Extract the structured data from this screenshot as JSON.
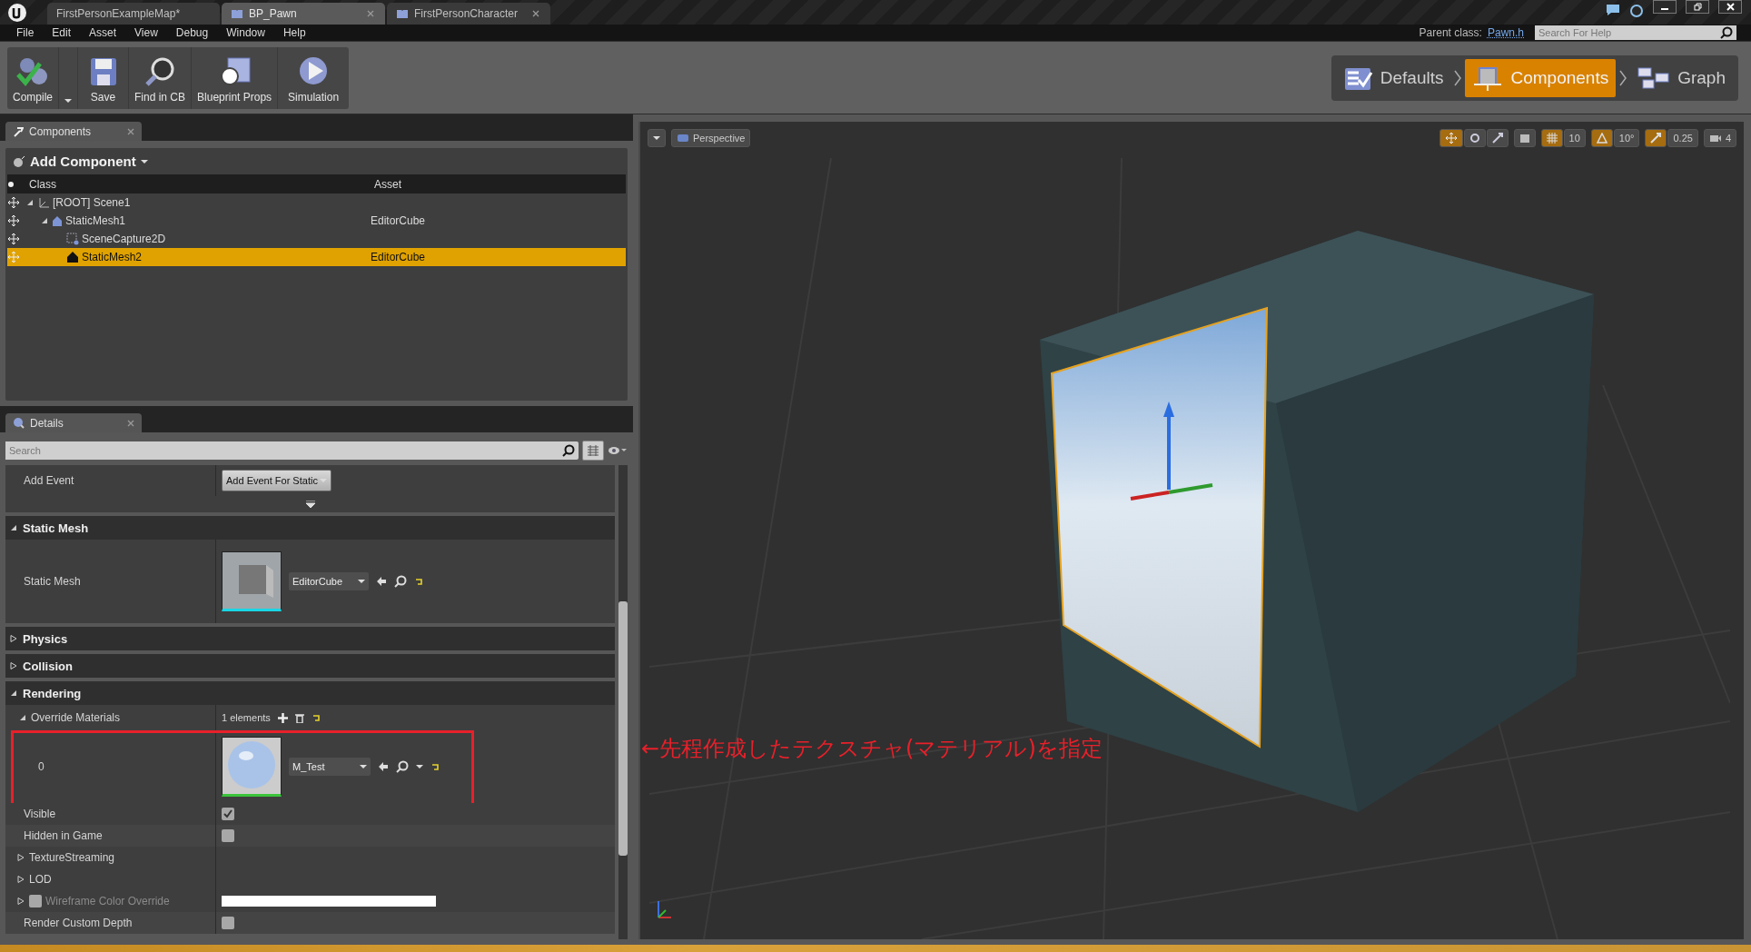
{
  "window": {
    "tabs": [
      {
        "label": "FirstPersonExampleMap*",
        "selected": false
      },
      {
        "label": "BP_Pawn",
        "selected": true
      },
      {
        "label": "FirstPersonCharacter",
        "selected": false
      }
    ]
  },
  "menu": [
    "File",
    "Edit",
    "Asset",
    "View",
    "Debug",
    "Window",
    "Help"
  ],
  "parent_class": {
    "label": "Parent class:",
    "link": "Pawn.h"
  },
  "help_search": {
    "placeholder": "Search For Help"
  },
  "toolbar": [
    {
      "label": "Compile"
    },
    {
      "label": "Save"
    },
    {
      "label": "Find in CB"
    },
    {
      "label": "Blueprint Props"
    },
    {
      "label": "Simulation"
    }
  ],
  "modes": [
    {
      "label": "Defaults",
      "selected": false
    },
    {
      "label": "Components",
      "selected": true
    },
    {
      "label": "Graph",
      "selected": false
    }
  ],
  "components_panel": {
    "tab": "Components",
    "add_button": "Add Component",
    "columns": [
      "Class",
      "Asset"
    ],
    "tree": [
      {
        "kind": "scene",
        "class": "[ROOT] Scene1",
        "selected": false,
        "expanded": true,
        "children": [
          {
            "kind": "mesh",
            "class": "StaticMesh1",
            "asset": "EditorCube",
            "selected": false,
            "expanded": true,
            "children": [
              {
                "kind": "capture",
                "class": "SceneCapture2D",
                "selected": false
              },
              {
                "kind": "solid",
                "class": "StaticMesh2",
                "asset": "EditorCube",
                "selected": true
              }
            ]
          }
        ]
      }
    ]
  },
  "details_panel": {
    "tab": "Details",
    "search": {
      "placeholder": "Search"
    },
    "sections": [
      {
        "rows": [
          {
            "kind": "event",
            "label": "Add Event",
            "button": "Add Event For Static"
          }
        ]
      },
      {
        "title": "Static Mesh",
        "expanded": true,
        "rows": [
          {
            "kind": "asset",
            "label": "Static Mesh",
            "value": "EditorCube"
          }
        ]
      },
      {
        "title": "Physics",
        "expanded": false
      },
      {
        "title": "Collision",
        "expanded": false
      },
      {
        "title": "Rendering",
        "expanded": true,
        "rows": [
          {
            "kind": "array",
            "label": "Override Materials",
            "expanded": true,
            "value": "1 elements"
          },
          {
            "kind": "material",
            "label": "0",
            "value": "M_Test",
            "highlighted": true
          },
          {
            "kind": "checkbox",
            "label": "Visible",
            "checked": true
          },
          {
            "kind": "checkbox",
            "label": "Hidden in Game",
            "checked": false
          },
          {
            "kind": "group",
            "label": "TextureStreaming",
            "expanded": false
          },
          {
            "kind": "group",
            "label": "LOD",
            "expanded": false
          },
          {
            "kind": "color",
            "label": "Wireframe Color Override",
            "expanded": false,
            "checked": false,
            "disabled": true
          },
          {
            "kind": "checkbox",
            "label": "Render Custom Depth",
            "checked": false
          }
        ]
      }
    ]
  },
  "annotation": {
    "text": "←先程作成したテクスチャ(マテリアル)を指定"
  },
  "viewport": {
    "view_button": "Perspective",
    "transform_tools": [
      {
        "selected": true
      },
      {
        "selected": false
      },
      {
        "selected": false
      }
    ],
    "snaps": [
      {
        "value": "10",
        "on": true
      },
      {
        "value": "10°",
        "on": true
      },
      {
        "value": "0.25",
        "on": true
      }
    ],
    "camera_speed": "4"
  }
}
